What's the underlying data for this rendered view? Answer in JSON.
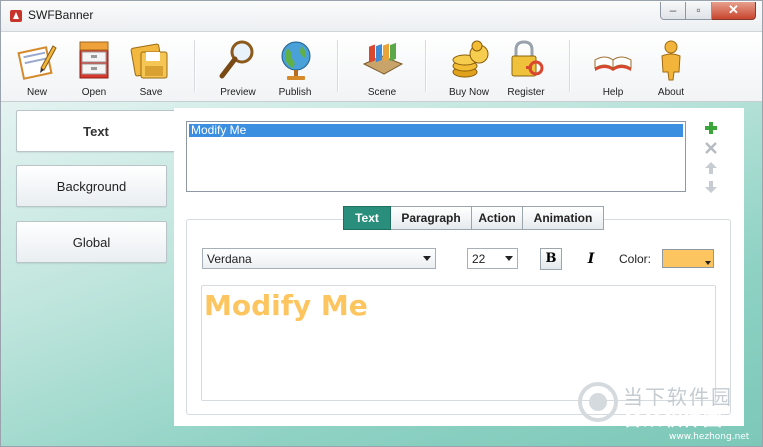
{
  "window": {
    "title": "SWFBanner"
  },
  "toolbar": {
    "new_label": "New",
    "open_label": "Open",
    "save_label": "Save",
    "preview_label": "Preview",
    "publish_label": "Publish",
    "scene_label": "Scene",
    "buy_now_label": "Buy Now",
    "register_label": "Register",
    "help_label": "Help",
    "about_label": "About"
  },
  "sidebar": {
    "items": [
      {
        "label": "Text",
        "active": true
      },
      {
        "label": "Background",
        "active": false
      },
      {
        "label": "Global",
        "active": false
      }
    ]
  },
  "text_list": {
    "items": [
      "Modify Me"
    ],
    "selected": "Modify Me"
  },
  "list_tools": [
    "plus-icon",
    "delete-x-icon",
    "arrow-up-icon",
    "arrow-down-icon"
  ],
  "tabs": [
    {
      "label": "Text",
      "active": true
    },
    {
      "label": "Paragraph",
      "active": false
    },
    {
      "label": "Action",
      "active": false
    },
    {
      "label": "Animation",
      "active": false
    }
  ],
  "text_props": {
    "font": "Verdana",
    "size": "22",
    "bold_glyph": "B",
    "italic_glyph": "I",
    "color_label": "Color:",
    "color_value": "#fdc55f"
  },
  "preview": {
    "text": "Modify Me"
  },
  "watermark": {
    "top": "当下软件园",
    "bottom": "合众软件园",
    "url": "www.hezhong.net"
  },
  "colors": {
    "accent": "#2a8e7c",
    "selection": "#3b8fe0",
    "text_color": "#fdc55f"
  }
}
